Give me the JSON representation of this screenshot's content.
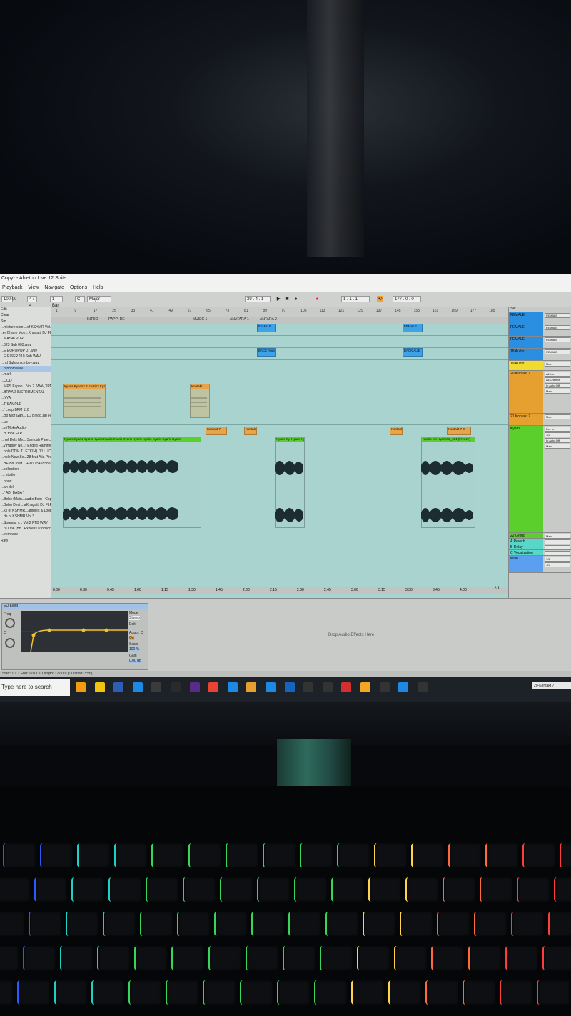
{
  "window": {
    "title": "Copy* - Ableton Live 12 Suite"
  },
  "menu": [
    "Playback",
    "View",
    "Navigate",
    "Options",
    "Help"
  ],
  "transport": {
    "tempo": "100.00",
    "signature": "4 / 4",
    "quantize": "1 Bar",
    "key": "C",
    "scale": "Major",
    "position": "39 . 4 . 1",
    "loop_start": "1 . 1 . 1",
    "loop_length": "177 . 0 . 0"
  },
  "browser": {
    "items": [
      "Edit",
      "Clear",
      "Sm...",
      "...mixture.com ...of KSHMR Vol.4",
      "..er Chane Mon...Khagatti DJ FLP",
      "...MASALPURI",
      "...023 Sub 003.wav",
      "...E EUROPOP 07.wav",
      "...E RISER 110 Sub.WAV",
      "...nd Subsonice boy.wav",
      "...h boom.wav",
      "...mark",
      "...OOD",
      "...MPS Expan... Vol.2 (WAV,XPN)",
      "...BRAAD INSTRUMENTAL",
      "...NYA",
      "...T SAMPLE",
      "...f Loop BPM 110",
      "...Bo Mor Gan... DJ Binod.zip File",
      "...uo",
      "...s (MokeAudio)",
      "...m tone FLP",
      "...rrel Dels Me... Santosh Patel.zip",
      "...y Happy Ne...t Ended Ramine.i",
      "...nole DDM T...ETKIM) DJ LUCKY",
      "...hole New Se...28 feat Alia Pine",
      "...BE Bh To M... +919754185859",
      "...collection",
      "...t studio",
      "...nport",
      "...ah del",
      "...( ADI BABA )",
      "...Bebo (Main...audio Box) - Copy",
      "...Bebo Desi ...aKhagatti DJ FLP",
      "...ks of KSHMR...amples & Loops)",
      "...ds of KSHMR Vol.3",
      "...Sounds, v... Vol.2 FTB WAV",
      "...ra Line (Bh...Express Prodtion",
      "...eem.wav",
      "Raw"
    ]
  },
  "arrangement": {
    "ruler_bars": [
      "1",
      "9",
      "17",
      "25",
      "33",
      "41",
      "49",
      "57",
      "65",
      "73",
      "81",
      "89",
      "97",
      "105",
      "113",
      "121",
      "129",
      "137",
      "145",
      "153",
      "161",
      "169",
      "177",
      "185"
    ],
    "locators": [
      "INTRO",
      "PAPPI DE",
      "MUSIC 1",
      "ANATARA 1",
      "ANTARA 2"
    ],
    "clip_labels": {
      "kontakt_a": "Kyaris Kyaris2 # Kyaris2 Kyaris",
      "kontakt_b": "Kontakt",
      "kontakt_c": "Kontakt 7",
      "kontakt_d": "Kontakt",
      "kontakt_e": "Kontakt",
      "kontakt_f": "Kontakt 7 3",
      "audio_a": "Kyaris Kyaris Kyaris Kyaris Kyaris Kyaris Kyaris Kyaris Kyaris Kyaris Kyaris Kyaris",
      "audio_b": "Kyaris Kyi Kyaris Ky",
      "audio_c": "Kyaris Kyi Kyaris#2_x64 (Freeze)",
      "back_a": "BACK Audio",
      "back_b": "BACK Audi",
      "female_a": "FEMALE",
      "female_b": "FEMALE"
    },
    "time_ticks": [
      "0:00",
      "0:30",
      "0:45",
      "1:00",
      "1:15",
      "1:30",
      "1:45",
      "2:00",
      "2:15",
      "2:30",
      "2:45",
      "3:00",
      "3:15",
      "3:30",
      "3:45",
      "4:00"
    ],
    "page_indicator": "2/1"
  },
  "mixer": {
    "set_button": "Set",
    "tracks": [
      {
        "name": "FEMALE",
        "io": [
          "FEMALE"
        ],
        "color": "#2a8fe0"
      },
      {
        "name": "FEMALE",
        "io": [
          "FEMALE"
        ],
        "color": "#2a8fe0"
      },
      {
        "name": "FEMALE",
        "io": [
          "FEMALE"
        ],
        "color": "#2a8fe0"
      },
      {
        "name": "18 Audio",
        "io": [
          "FEMALE"
        ],
        "color": "#2a8fe0"
      },
      {
        "name": "19 Audio",
        "io": [
          "Main"
        ],
        "color": "#f0dc30"
      },
      {
        "name": "20 Kontakt 7",
        "io": [
          "All Ins",
          "All Channe",
          "In Auto Off",
          "Main"
        ],
        "color": "#e6a030"
      },
      {
        "name": "21 Kontakt 7",
        "io": [
          "Main"
        ],
        "color": "#e6a030"
      },
      {
        "name": "Kyaris",
        "io": [
          "Ext. In",
          "1/2",
          "In Auto Off",
          "Main"
        ],
        "color": "#5bcf2b"
      },
      {
        "name": "22 Group",
        "io": [
          "Main"
        ],
        "color": "#5bcf2b"
      },
      {
        "name": "A Reverb",
        "io": [
          ""
        ],
        "color": "#58d6c8"
      },
      {
        "name": "B Delay",
        "io": [
          ""
        ],
        "color": "#58d6c8"
      },
      {
        "name": "C Vocalization",
        "io": [
          ""
        ],
        "color": "#58d6c8"
      },
      {
        "name": "Main",
        "io": [
          "1/2",
          "1/2"
        ],
        "color": "#5a9ff0"
      }
    ]
  },
  "detail": {
    "device_name": "EQ Eight",
    "mode_label": "Mode",
    "mode_value": "Stereo",
    "edit_label": "Edit",
    "adapt_label": "Adapt. Q",
    "adapt_value": "On",
    "scale_label": "Scale",
    "scale_value": "100 %",
    "gain_label": "Gain",
    "gain_value": "0.00 dB",
    "freq_label": "Freq",
    "q_label": "Q",
    "drop_hint": "Drop Audio Effects Here",
    "db_ticks": [
      "12",
      "6",
      "0",
      "-6",
      "-12"
    ],
    "freq_ticks": [
      "100",
      "1k",
      "10k"
    ]
  },
  "status_bar": {
    "text": "Start: 1.1.1   End: 178.1.1   Length: 177.0.0   (Duration: 3:56)"
  },
  "taskbar": {
    "search_placeholder": "Type here to search",
    "tray_label": "20-Kontakt 7",
    "apps": [
      "vlc-icon",
      "files-icon",
      "photoshop-icon",
      "media-icon",
      "illustrator-icon",
      "apps-icon",
      "player-icon",
      "chrome-icon",
      "arrow-app-icon",
      "shield-app-icon",
      "arrow-app-icon",
      "download-icon",
      "live-icon",
      "wave-icon",
      "record-icon",
      "fl-icon",
      "id-icon",
      "tool-icon",
      "live-active-icon"
    ]
  },
  "colors": {
    "arrangement_bg": "#a9d3cf",
    "clip_orange": "#e6a54a",
    "clip_green": "#5bcf2b",
    "clip_blue": "#3da2e8",
    "waveform": "#1d2b33"
  }
}
